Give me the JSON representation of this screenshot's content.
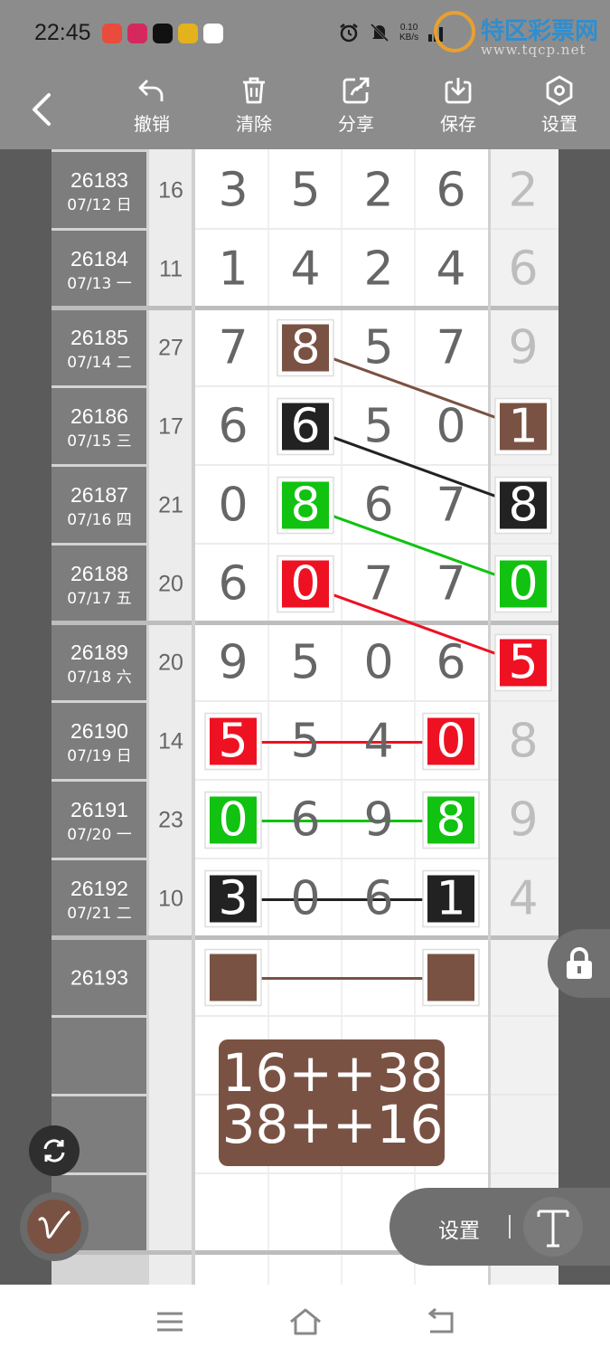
{
  "status_bar": {
    "time": "22:45",
    "net_speed_value": "0.10",
    "net_speed_unit": "KB/s",
    "app_icons": [
      {
        "name": "app-icon-1",
        "color": "#e94b3c"
      },
      {
        "name": "app-icon-2",
        "color": "#d6285d"
      },
      {
        "name": "tiktok-icon",
        "color": "#111111"
      },
      {
        "name": "app-icon-4",
        "color": "#e3b21d"
      },
      {
        "name": "qq-icon",
        "color": "#ffffff"
      }
    ],
    "system_icons": [
      "alarm-icon",
      "mute-icon",
      "signal-icon",
      "wifi-icon"
    ]
  },
  "watermark": {
    "name": "特区彩票网",
    "url": "www.tqcp.net"
  },
  "toolbar": {
    "items": [
      {
        "label": "撤销",
        "icon": "undo-icon"
      },
      {
        "label": "清除",
        "icon": "trash-icon"
      },
      {
        "label": "分享",
        "icon": "share-icon"
      },
      {
        "label": "保存",
        "icon": "download-icon"
      },
      {
        "label": "设置",
        "icon": "settings-icon"
      }
    ]
  },
  "table": {
    "rows": [
      {
        "period": "26183",
        "date": "07/12 日",
        "sum": "16",
        "digits": [
          "3",
          "5",
          "2",
          "6"
        ],
        "extra": "2"
      },
      {
        "period": "26184",
        "date": "07/13 一",
        "sum": "11",
        "digits": [
          "1",
          "4",
          "2",
          "4"
        ],
        "extra": "6"
      },
      {
        "period": "26185",
        "date": "07/14 二",
        "sum": "27",
        "digits": [
          "7",
          "8",
          "5",
          "7"
        ],
        "extra": "9"
      },
      {
        "period": "26186",
        "date": "07/15 三",
        "sum": "17",
        "digits": [
          "6",
          "6",
          "5",
          "0"
        ],
        "extra": "1"
      },
      {
        "period": "26187",
        "date": "07/16 四",
        "sum": "21",
        "digits": [
          "0",
          "8",
          "6",
          "7"
        ],
        "extra": "8"
      },
      {
        "period": "26188",
        "date": "07/17 五",
        "sum": "20",
        "digits": [
          "6",
          "0",
          "7",
          "7"
        ],
        "extra": "0"
      },
      {
        "period": "26189",
        "date": "07/18 六",
        "sum": "20",
        "digits": [
          "9",
          "5",
          "0",
          "6"
        ],
        "extra": "5"
      },
      {
        "period": "26190",
        "date": "07/19 日",
        "sum": "14",
        "digits": [
          "5",
          "5",
          "4",
          "0"
        ],
        "extra": "8"
      },
      {
        "period": "26191",
        "date": "07/20 一",
        "sum": "23",
        "digits": [
          "0",
          "6",
          "9",
          "8"
        ],
        "extra": "9"
      },
      {
        "period": "26192",
        "date": "07/21 二",
        "sum": "10",
        "digits": [
          "3",
          "0",
          "6",
          "1"
        ],
        "extra": "4"
      },
      {
        "period": "26193",
        "date": "",
        "sum": "",
        "digits": [
          "",
          "",
          "",
          ""
        ],
        "extra": ""
      },
      {
        "period": "",
        "date": "",
        "sum": "",
        "digits": [
          "",
          "",
          "",
          ""
        ],
        "extra": ""
      },
      {
        "period": "",
        "date": "",
        "sum": "",
        "digits": [
          "",
          "",
          "",
          ""
        ],
        "extra": ""
      },
      {
        "period": "",
        "date": "",
        "sum": "",
        "digits": [
          "",
          "",
          "",
          ""
        ],
        "extra": ""
      }
    ],
    "marks": [
      {
        "row": 2,
        "col": 1,
        "color": "#7a5243"
      },
      {
        "row": 3,
        "col": 4,
        "color": "#7a5243"
      },
      {
        "row": 3,
        "col": 1,
        "color": "#222222"
      },
      {
        "row": 4,
        "col": 4,
        "color": "#222222"
      },
      {
        "row": 4,
        "col": 1,
        "color": "#11c211"
      },
      {
        "row": 5,
        "col": 4,
        "color": "#11c211"
      },
      {
        "row": 5,
        "col": 1,
        "color": "#ee1122"
      },
      {
        "row": 6,
        "col": 4,
        "color": "#ee1122"
      },
      {
        "row": 7,
        "col": 0,
        "color": "#ee1122"
      },
      {
        "row": 7,
        "col": 3,
        "color": "#ee1122"
      },
      {
        "row": 8,
        "col": 0,
        "color": "#11c211"
      },
      {
        "row": 8,
        "col": 3,
        "color": "#11c211"
      },
      {
        "row": 9,
        "col": 0,
        "color": "#222222"
      },
      {
        "row": 9,
        "col": 3,
        "color": "#222222"
      },
      {
        "row": 10,
        "col": 0,
        "color": "#7a5243"
      },
      {
        "row": 10,
        "col": 3,
        "color": "#7a5243"
      }
    ],
    "lines": [
      {
        "from": [
          2,
          1
        ],
        "to": [
          3,
          4
        ],
        "color": "#7a5243"
      },
      {
        "from": [
          3,
          1
        ],
        "to": [
          4,
          4
        ],
        "color": "#222222"
      },
      {
        "from": [
          4,
          1
        ],
        "to": [
          5,
          4
        ],
        "color": "#11c211"
      },
      {
        "from": [
          5,
          1
        ],
        "to": [
          6,
          4
        ],
        "color": "#ee1122"
      },
      {
        "from": [
          7,
          0
        ],
        "to": [
          7,
          3
        ],
        "color": "#ee1122"
      },
      {
        "from": [
          8,
          0
        ],
        "to": [
          8,
          3
        ],
        "color": "#11c211"
      },
      {
        "from": [
          9,
          0
        ],
        "to": [
          9,
          3
        ],
        "color": "#222222"
      },
      {
        "from": [
          10,
          0
        ],
        "to": [
          10,
          3
        ],
        "color": "#7a5243"
      }
    ],
    "note_line_1": "16++38",
    "note_line_2": "38++16",
    "note_color": "#7a5243"
  },
  "controls": {
    "lock_icon": "lock-icon",
    "rotate_icon": "rotate-icon",
    "pen_icon": "pen-icon",
    "settings_label": "设置",
    "text_tool_icon": "text-tool-icon"
  },
  "navbar": {
    "icons": [
      "menu-icon",
      "home-icon",
      "back-nav-icon"
    ]
  }
}
